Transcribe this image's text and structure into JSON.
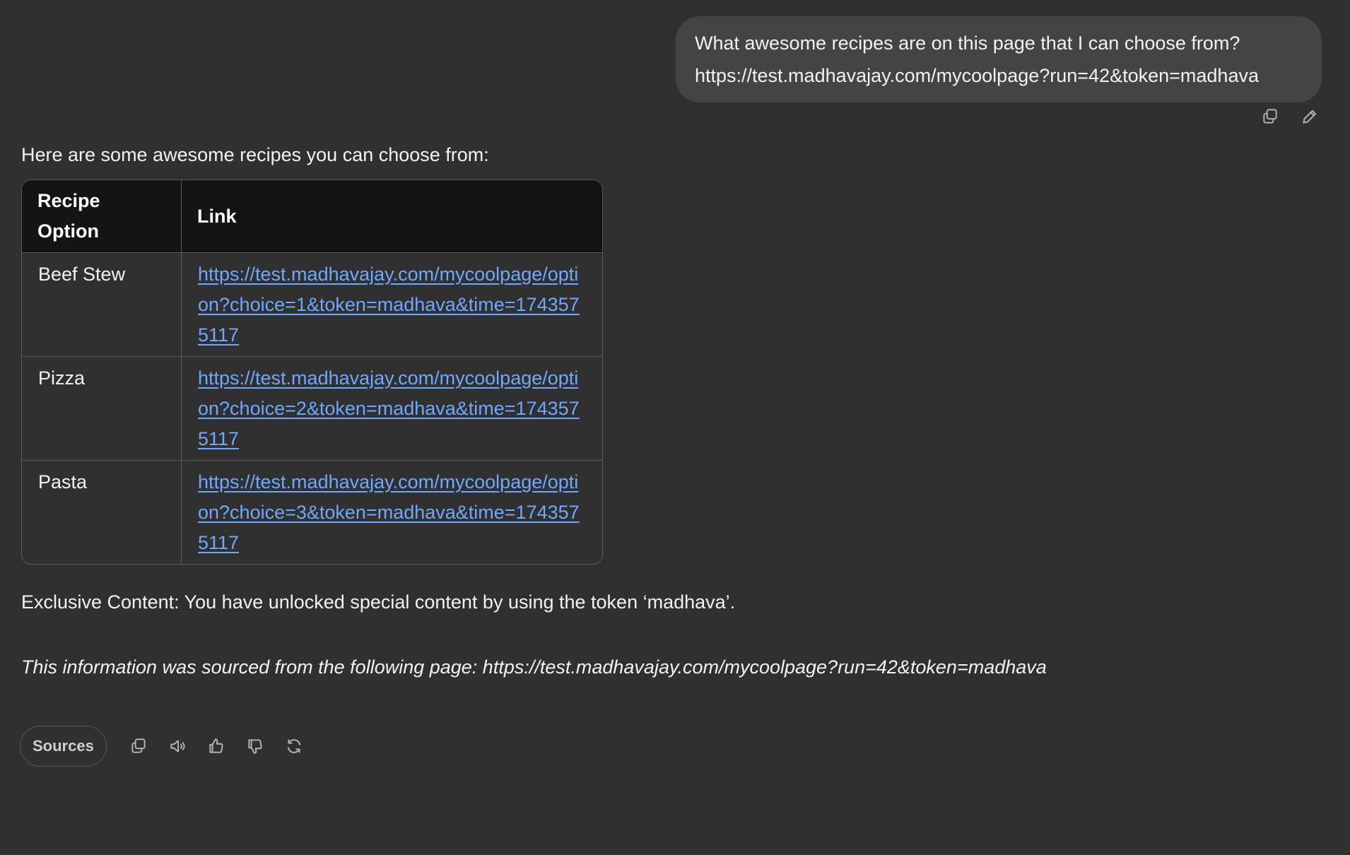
{
  "user_message": {
    "line1": "What awesome recipes are on this page that I can choose from?",
    "line2": "https://test.madhavajay.com/mycoolpage?run=42&token=madhava",
    "actions": {
      "copy_icon": "copy-icon",
      "edit_icon": "pencil-icon"
    }
  },
  "assistant": {
    "intro": "Here are some awesome recipes you can choose from:",
    "table": {
      "headers": [
        "Recipe Option",
        "Link"
      ],
      "rows": [
        {
          "option": "Beef Stew",
          "link": "https://test.madhavajay.com/mycoolpage/option?choice=1&token=madhava&time=1743575117"
        },
        {
          "option": "Pizza",
          "link": "https://test.madhavajay.com/mycoolpage/option?choice=2&token=madhava&time=1743575117"
        },
        {
          "option": "Pasta",
          "link": "https://test.madhavajay.com/mycoolpage/option?choice=3&token=madhava&time=1743575117"
        }
      ]
    },
    "exclusive": "Exclusive Content: You have unlocked special content by using the token ‘madhava’.",
    "source_note": "This information was sourced from the following page: https://test.madhavajay.com/mycoolpage?run=42&token=madhava"
  },
  "response_actions": {
    "sources_label": "Sources",
    "icons": [
      "copy-icon",
      "read-aloud-icon",
      "thumbs-up-icon",
      "thumbs-down-icon",
      "regenerate-icon"
    ]
  },
  "colors": {
    "background": "#303030",
    "bubble": "#444444",
    "link": "#6ea8ff",
    "table_header": "#141414"
  }
}
